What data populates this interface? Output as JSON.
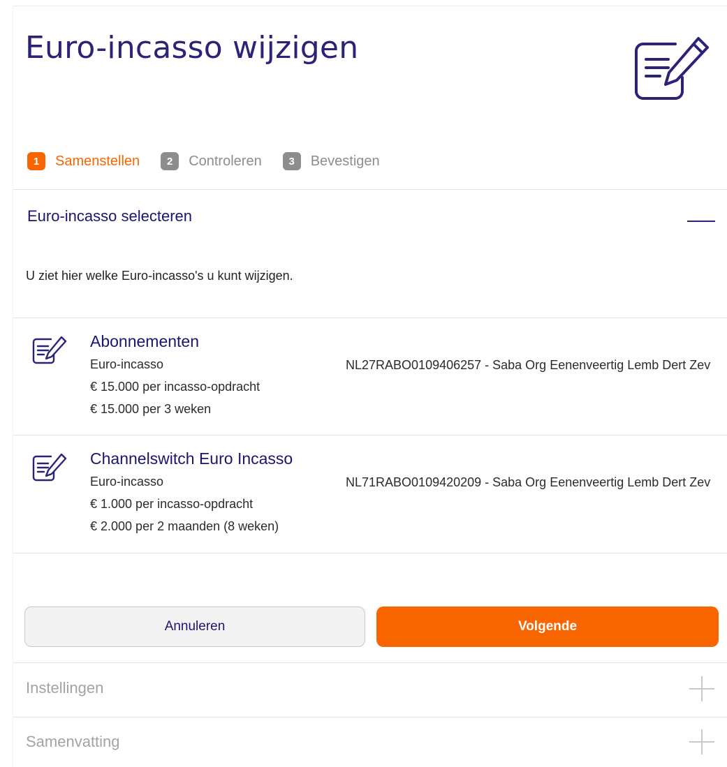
{
  "page": {
    "title": "Euro-incasso wijzigen",
    "icon": "document-edit-icon"
  },
  "steps": [
    {
      "number": "1",
      "label": "Samenstellen",
      "state": "active"
    },
    {
      "number": "2",
      "label": "Controleren",
      "state": "inactive"
    },
    {
      "number": "3",
      "label": "Bevestigen",
      "state": "inactive"
    }
  ],
  "select_section": {
    "title": "Euro-incasso selecteren",
    "intro": "U ziet hier welke Euro-incasso's u kunt wijzigen.",
    "items": [
      {
        "icon": "document-edit-icon",
        "name": "Abonnementen",
        "type": "Euro-incasso",
        "limit_per_order": "€ 15.000 per incasso-opdracht",
        "limit_period": "€ 15.000 per 3 weken",
        "account": "NL27RABO0109406257 - Saba Org Eenenveertig Lemb Dert Zev"
      },
      {
        "icon": "document-edit-icon",
        "name": "Channelswitch Euro Incasso",
        "type": "Euro-incasso",
        "limit_per_order": "€ 1.000 per incasso-opdracht",
        "limit_period": "€ 2.000 per 2 maanden (8 weken)",
        "account": "NL71RABO0109420209 - Saba Org Eenenveertig Lemb Dert Zev"
      }
    ]
  },
  "buttons": {
    "cancel": "Annuleren",
    "next": "Volgende"
  },
  "accordions": [
    {
      "title": "Instellingen"
    },
    {
      "title": "Samenvatting"
    }
  ],
  "colors": {
    "accent": "#f96600",
    "brand": "#1b1570",
    "muted": "#8d8d8d"
  }
}
